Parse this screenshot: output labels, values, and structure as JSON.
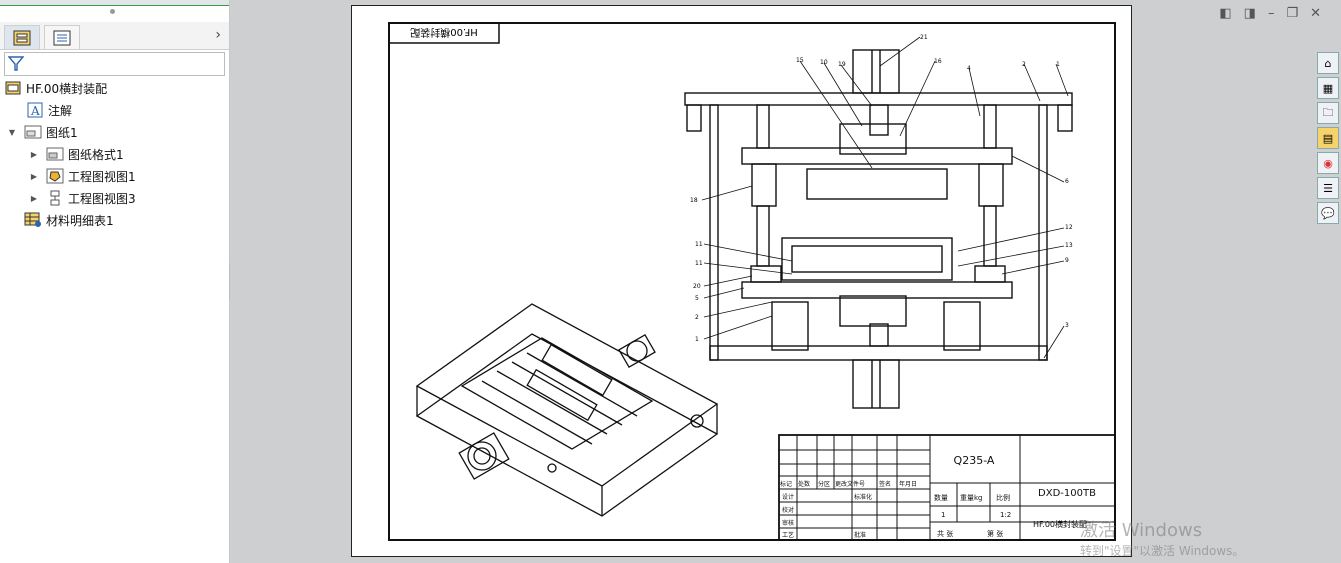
{
  "tree": {
    "root_label": "HF.00横封装配",
    "items": [
      {
        "label": "注解"
      },
      {
        "label": "图纸1"
      },
      {
        "label": "图纸格式1"
      },
      {
        "label": "工程图视图1"
      },
      {
        "label": "工程图视图3"
      },
      {
        "label": "材料明细表1"
      }
    ]
  },
  "drawing": {
    "rotated_title": "HF.00横封装配",
    "material": "Q235-A",
    "part_code": "DXD-100TB",
    "assembly_name": "HF.00横封装配",
    "qty_header": "数量",
    "weight_header": "重量kg",
    "scale_header": "比例",
    "qty_value": "1",
    "scale_value": "1:2",
    "sheet_total": "共 张",
    "sheet_no": "第 张",
    "rev_headers": [
      "标记",
      "处数",
      "分区",
      "更改文件号",
      "签名",
      "年月日"
    ],
    "sign_rows": [
      "设计",
      "校对",
      "审核",
      "工艺"
    ],
    "approval": "批准",
    "std": "标准化",
    "balloons_right": [
      "21",
      "16",
      "4",
      "2",
      "1",
      "6",
      "12",
      "13",
      "9",
      "3"
    ],
    "balloons_left": [
      "15",
      "10",
      "19",
      "18",
      "11",
      "11",
      "20",
      "5",
      "2",
      "1"
    ]
  },
  "icons": {
    "filter": "filter-icon",
    "home": "home-icon",
    "parts": "parts-icon",
    "folder": "folder-icon",
    "assembly": "assembly-icon",
    "appearance": "appearance-icon",
    "properties": "properties-icon",
    "forum": "forum-icon"
  },
  "watermark": {
    "line1": "激活 Windows",
    "line2": "转到\"设置\"以激活 Windows。"
  }
}
